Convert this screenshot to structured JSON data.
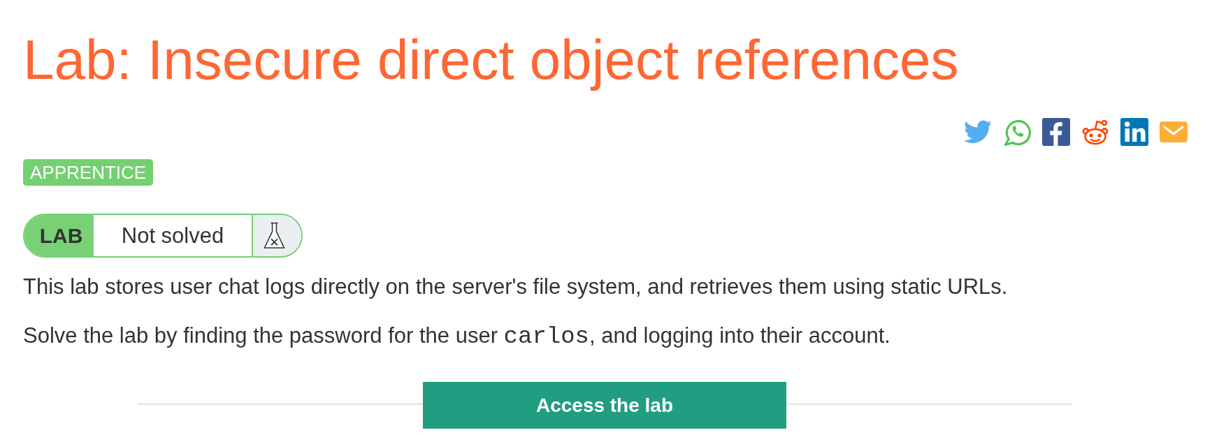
{
  "title": "Lab: Insecure direct object references",
  "level_badge": {
    "label": "APPRENTICE"
  },
  "lab_status": {
    "label": "LAB",
    "status": "Not solved",
    "solved": false
  },
  "description": [
    {
      "parts": [
        {
          "kind": "text",
          "text": "This lab stores user chat logs directly on the server's file system, and retrieves them using static URLs."
        }
      ]
    },
    {
      "parts": [
        {
          "kind": "text",
          "text": "Solve the lab by finding the password for the user "
        },
        {
          "kind": "code",
          "text": "carlos"
        },
        {
          "kind": "text",
          "text": ", and logging into their account."
        }
      ]
    }
  ],
  "access_button": {
    "label": "Access the lab"
  }
}
